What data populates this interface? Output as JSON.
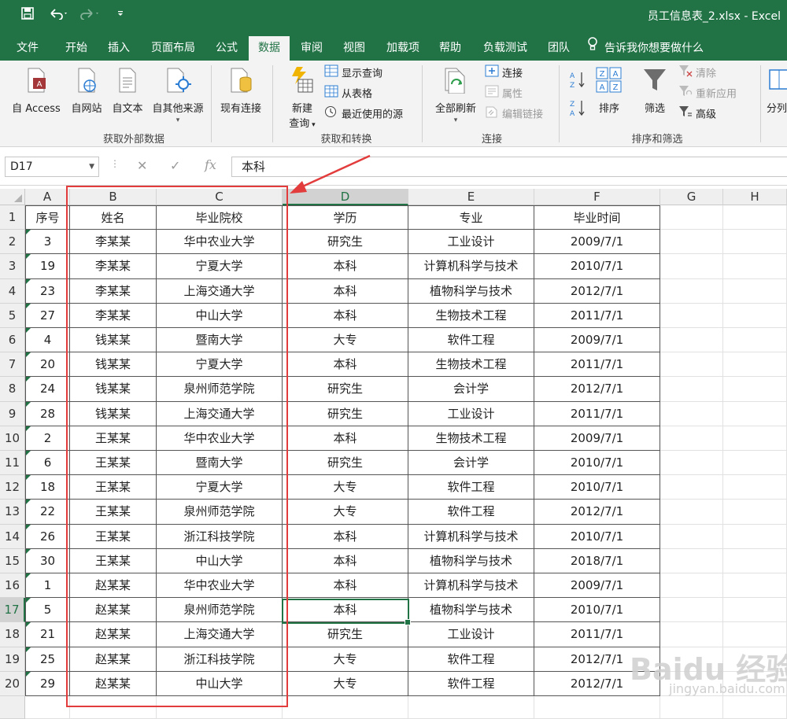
{
  "app": {
    "title": "员工信息表_2.xlsx  -  Excel",
    "accent": "#217346"
  },
  "tabs": [
    "文件",
    "开始",
    "插入",
    "页面布局",
    "公式",
    "数据",
    "审阅",
    "视图",
    "加载项",
    "帮助",
    "负载测试",
    "团队"
  ],
  "active_tab": "数据",
  "tell_me": "告诉我你想要做什么",
  "ribbon": {
    "get_external": {
      "label": "获取外部数据",
      "from_access": "自 Access",
      "from_web": "自网站",
      "from_text": "自文本",
      "from_other": "自其他来源",
      "existing": "现有连接"
    },
    "get_transform": {
      "label": "获取和转换",
      "new_query_1": "新建",
      "new_query_2": "查询",
      "show_queries": "显示查询",
      "from_table": "从表格",
      "recent_sources": "最近使用的源"
    },
    "connections": {
      "label": "连接",
      "refresh_all": "全部刷新",
      "connections": "连接",
      "properties": "属性",
      "edit_links": "编辑链接"
    },
    "sort_filter": {
      "label": "排序和筛选",
      "sort": "排序",
      "filter": "筛选",
      "clear": "清除",
      "reapply": "重新应用",
      "advanced": "高级"
    },
    "more": "分列"
  },
  "formula_bar": {
    "name_box": "D17",
    "fx": "fx",
    "content": "本科"
  },
  "grid": {
    "columns": [
      "A",
      "B",
      "C",
      "D",
      "E",
      "F",
      "G",
      "H"
    ],
    "selected_column": "D",
    "selected_row": 17,
    "header": [
      "序号",
      "姓名",
      "毕业院校",
      "学历",
      "专业",
      "毕业时间"
    ],
    "rows": [
      [
        "3",
        "李某某",
        "华中农业大学",
        "研究生",
        "工业设计",
        "2009/7/1"
      ],
      [
        "19",
        "李某某",
        "宁夏大学",
        "本科",
        "计算机科学与技术",
        "2010/7/1"
      ],
      [
        "23",
        "李某某",
        "上海交通大学",
        "本科",
        "植物科学与技术",
        "2012/7/1"
      ],
      [
        "27",
        "李某某",
        "中山大学",
        "本科",
        "生物技术工程",
        "2011/7/1"
      ],
      [
        "4",
        "钱某某",
        "暨南大学",
        "大专",
        "软件工程",
        "2009/7/1"
      ],
      [
        "20",
        "钱某某",
        "宁夏大学",
        "本科",
        "生物技术工程",
        "2011/7/1"
      ],
      [
        "24",
        "钱某某",
        "泉州师范学院",
        "研究生",
        "会计学",
        "2012/7/1"
      ],
      [
        "28",
        "钱某某",
        "上海交通大学",
        "研究生",
        "工业设计",
        "2011/7/1"
      ],
      [
        "2",
        "王某某",
        "华中农业大学",
        "本科",
        "生物技术工程",
        "2009/7/1"
      ],
      [
        "6",
        "王某某",
        "暨南大学",
        "研究生",
        "会计学",
        "2010/7/1"
      ],
      [
        "18",
        "王某某",
        "宁夏大学",
        "大专",
        "软件工程",
        "2010/7/1"
      ],
      [
        "22",
        "王某某",
        "泉州师范学院",
        "大专",
        "软件工程",
        "2012/7/1"
      ],
      [
        "26",
        "王某某",
        "浙江科技学院",
        "本科",
        "计算机科学与技术",
        "2010/7/1"
      ],
      [
        "30",
        "王某某",
        "中山大学",
        "本科",
        "植物科学与技术",
        "2018/7/1"
      ],
      [
        "1",
        "赵某某",
        "华中农业大学",
        "本科",
        "计算机科学与技术",
        "2009/7/1"
      ],
      [
        "5",
        "赵某某",
        "泉州师范学院",
        "本科",
        "植物科学与技术",
        "2010/7/1"
      ],
      [
        "21",
        "赵某某",
        "上海交通大学",
        "研究生",
        "工业设计",
        "2011/7/1"
      ],
      [
        "25",
        "赵某某",
        "浙江科技学院",
        "大专",
        "软件工程",
        "2012/7/1"
      ],
      [
        "29",
        "赵某某",
        "中山大学",
        "大专",
        "软件工程",
        "2012/7/1"
      ]
    ]
  },
  "watermark": {
    "main": "Baidu 经验",
    "sub": "jingyan.baidu.com"
  }
}
